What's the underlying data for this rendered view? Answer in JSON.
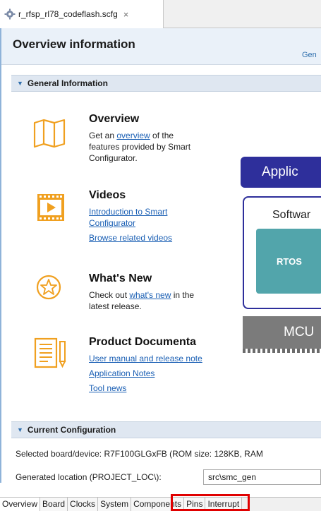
{
  "editor_tab": {
    "title": "r_rfsp_rl78_codeflash.scfg",
    "close": "×",
    "icon": "gear-icon"
  },
  "header": {
    "title": "Overview information",
    "right_link": "Gen"
  },
  "general_section": {
    "title": "General Information"
  },
  "overview": {
    "title": "Overview",
    "text_before": "Get an ",
    "link": "overview",
    "text_after": " of the features provided by Smart Configurator.",
    "line2": "features provided by Smart",
    "line3": "Configurator."
  },
  "videos": {
    "title": "Videos",
    "link1_line1": "Introduction to Smart",
    "link1_line2": "Configurator",
    "link2": "Browse related videos"
  },
  "whats_new": {
    "title": "What's New",
    "text_before": "Check out ",
    "link": "what's new",
    "text_after": " in the",
    "line2": "latest release."
  },
  "product_docs": {
    "title": "Product Documenta",
    "link1": "User manual and release note",
    "link2": "Application Notes",
    "link3": "Tool news"
  },
  "diagram": {
    "application": "Applic",
    "software": "Softwar",
    "rtos": "RTOS",
    "mcu": "MCU"
  },
  "current_config": {
    "title": "Current Configuration",
    "board_label": "Selected board/device:",
    "board_value": "R7F100GLGxFB (ROM size: 128KB, RAM",
    "location_label": "Generated location (PROJECT_LOC\\):",
    "location_value": "src\\smc_gen"
  },
  "bottom_tabs": [
    "Overview",
    "Board",
    "Clocks",
    "System",
    "Components",
    "Pins",
    "Interrupt"
  ],
  "colors": {
    "accent_blue": "#2e2f9b",
    "rtos_teal": "#52a5ab",
    "icon_orange": "#f0a020",
    "highlight": "#e00000"
  }
}
